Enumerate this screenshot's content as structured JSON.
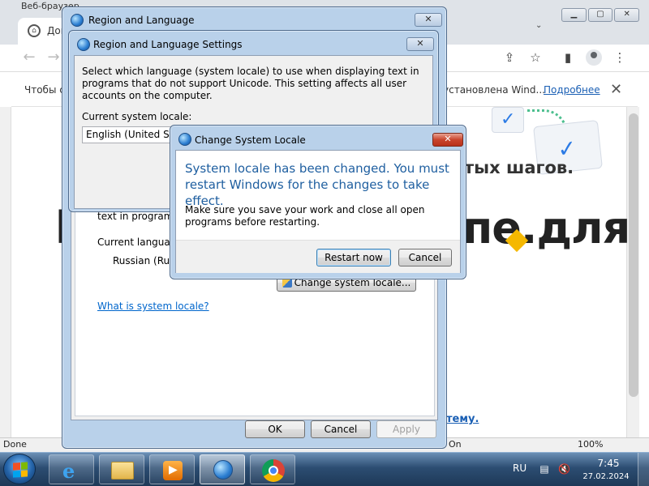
{
  "browser": {
    "window_title": "Веб-браузер",
    "tab_title": "Доку",
    "infobar_text": "Чтобы с",
    "infobar_text2": "установлена Wind...",
    "infobar_link": "Подробнее",
    "heading": "тых шагов.",
    "big_text": "пе.для",
    "big_text_left": "l",
    "bottom_link": "тему.",
    "status_text": "Done",
    "status_on": "On",
    "status_zoom": "100%",
    "icons": [
      "back-icon",
      "forward-icon",
      "share-icon",
      "star-icon",
      "sidebar-icon",
      "profile-icon",
      "menu-icon"
    ]
  },
  "region_dialog": {
    "title": "Region and Language",
    "close_label": "✕",
    "text_fragment": "text in programs t",
    "current_language_label": "Current language",
    "current_language_value": "Russian (Russ",
    "change_locale_button": "Change system locale...",
    "what_is_link": "What is system locale?",
    "ok": "OK",
    "cancel": "Cancel",
    "apply": "Apply"
  },
  "settings_dialog": {
    "title": "Region and Language Settings",
    "close_label": "✕",
    "description": "Select which language (system locale) to use when displaying text in programs that do not support Unicode. This setting affects all user accounts on the computer.",
    "current_locale_label": "Current system locale:",
    "current_locale_value": "English (United State"
  },
  "locale_dialog": {
    "title": "Change System Locale",
    "close_label": "✕",
    "heading": "System locale has been changed. You must restart Windows for the changes to take effect.",
    "body": "Make sure you save your work and close all open programs before restarting.",
    "restart_button": "Restart now",
    "cancel_button": "Cancel"
  },
  "taskbar": {
    "items": [
      "start-button",
      "internet-explorer",
      "file-explorer",
      "media-player",
      "region-and-language",
      "google-chrome"
    ],
    "language": "RU",
    "time": "7:45",
    "date": "27.02.2024"
  },
  "colors": {
    "accent_blue": "#1f5fa0",
    "link_blue": "#0066cc",
    "close_red": "#c9452d",
    "highlight_yellow": "#f5b800"
  }
}
